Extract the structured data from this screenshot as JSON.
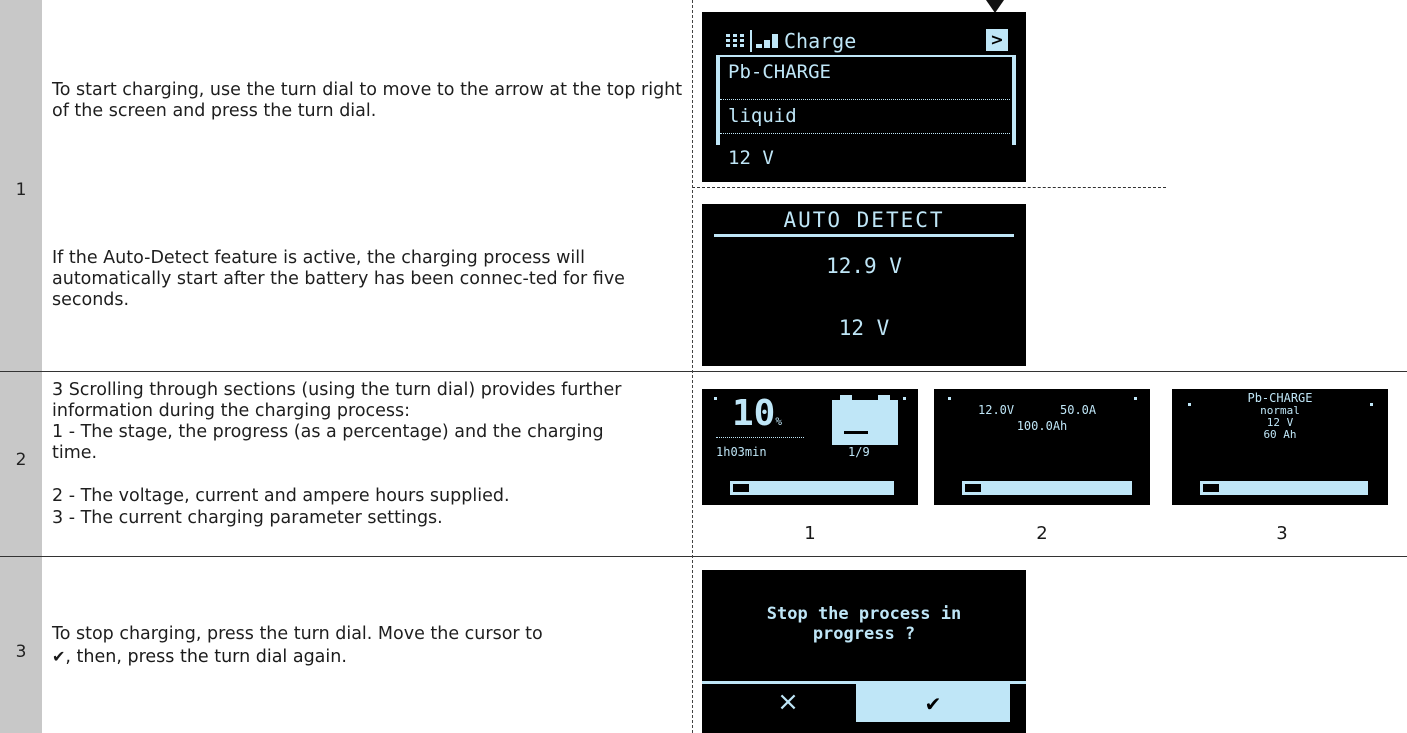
{
  "colors": {
    "screen_bg": "#000000",
    "screen_fg": "#bfe6f7",
    "step_col": "#c8c8c8"
  },
  "steps": [
    {
      "number": "1",
      "text_a": "To start charging, use the turn dial to move to the arrow at the top right of the screen and press the turn dial.",
      "text_b": "If the Auto-Detect feature is active, the charging process will automatically start after the battery has been connec-ted for five seconds."
    },
    {
      "number": "2",
      "intro": "3 Scrolling through sections (using the turn dial) provides further information during the charging process:",
      "items": [
        "1 - The stage, the progress (as a percentage) and the charging time.",
        "2 - The voltage, current and ampere hours supplied.",
        "3 - The current charging parameter settings."
      ]
    },
    {
      "number": "3",
      "text_a": "To stop charging, press the turn dial. Move the cursor to",
      "text_b": ", then, press the turn dial again."
    }
  ],
  "screen_charge": {
    "title": "Charge",
    "icons": [
      "menu-grid-icon",
      "signal-bars-icon",
      "right-arrow-icon"
    ],
    "arrow": ">",
    "rows": [
      "Pb-CHARGE",
      "liquid",
      "12 V"
    ]
  },
  "screen_auto": {
    "title": "AUTO DETECT",
    "voltage": "12.9 V",
    "nominal": "12 V"
  },
  "screen_progress": {
    "percent_value": "10",
    "percent_unit": "%",
    "time": "1h03min",
    "stage": "1/9",
    "progress": 0.1,
    "caption": "1"
  },
  "screen_values": {
    "voltage": "12.0V",
    "current": "50.0A",
    "amp_hours": "100.0Ah",
    "progress": 0.1,
    "caption": "2"
  },
  "screen_params": {
    "mode": "Pb-CHARGE",
    "type": "normal",
    "voltage": "12 V",
    "capacity": "60 Ah",
    "progress": 0.1,
    "caption": "3"
  },
  "screen_stop": {
    "line1": "Stop the process in",
    "line2": "progress ?",
    "cancel": "×",
    "confirm": "✔"
  }
}
